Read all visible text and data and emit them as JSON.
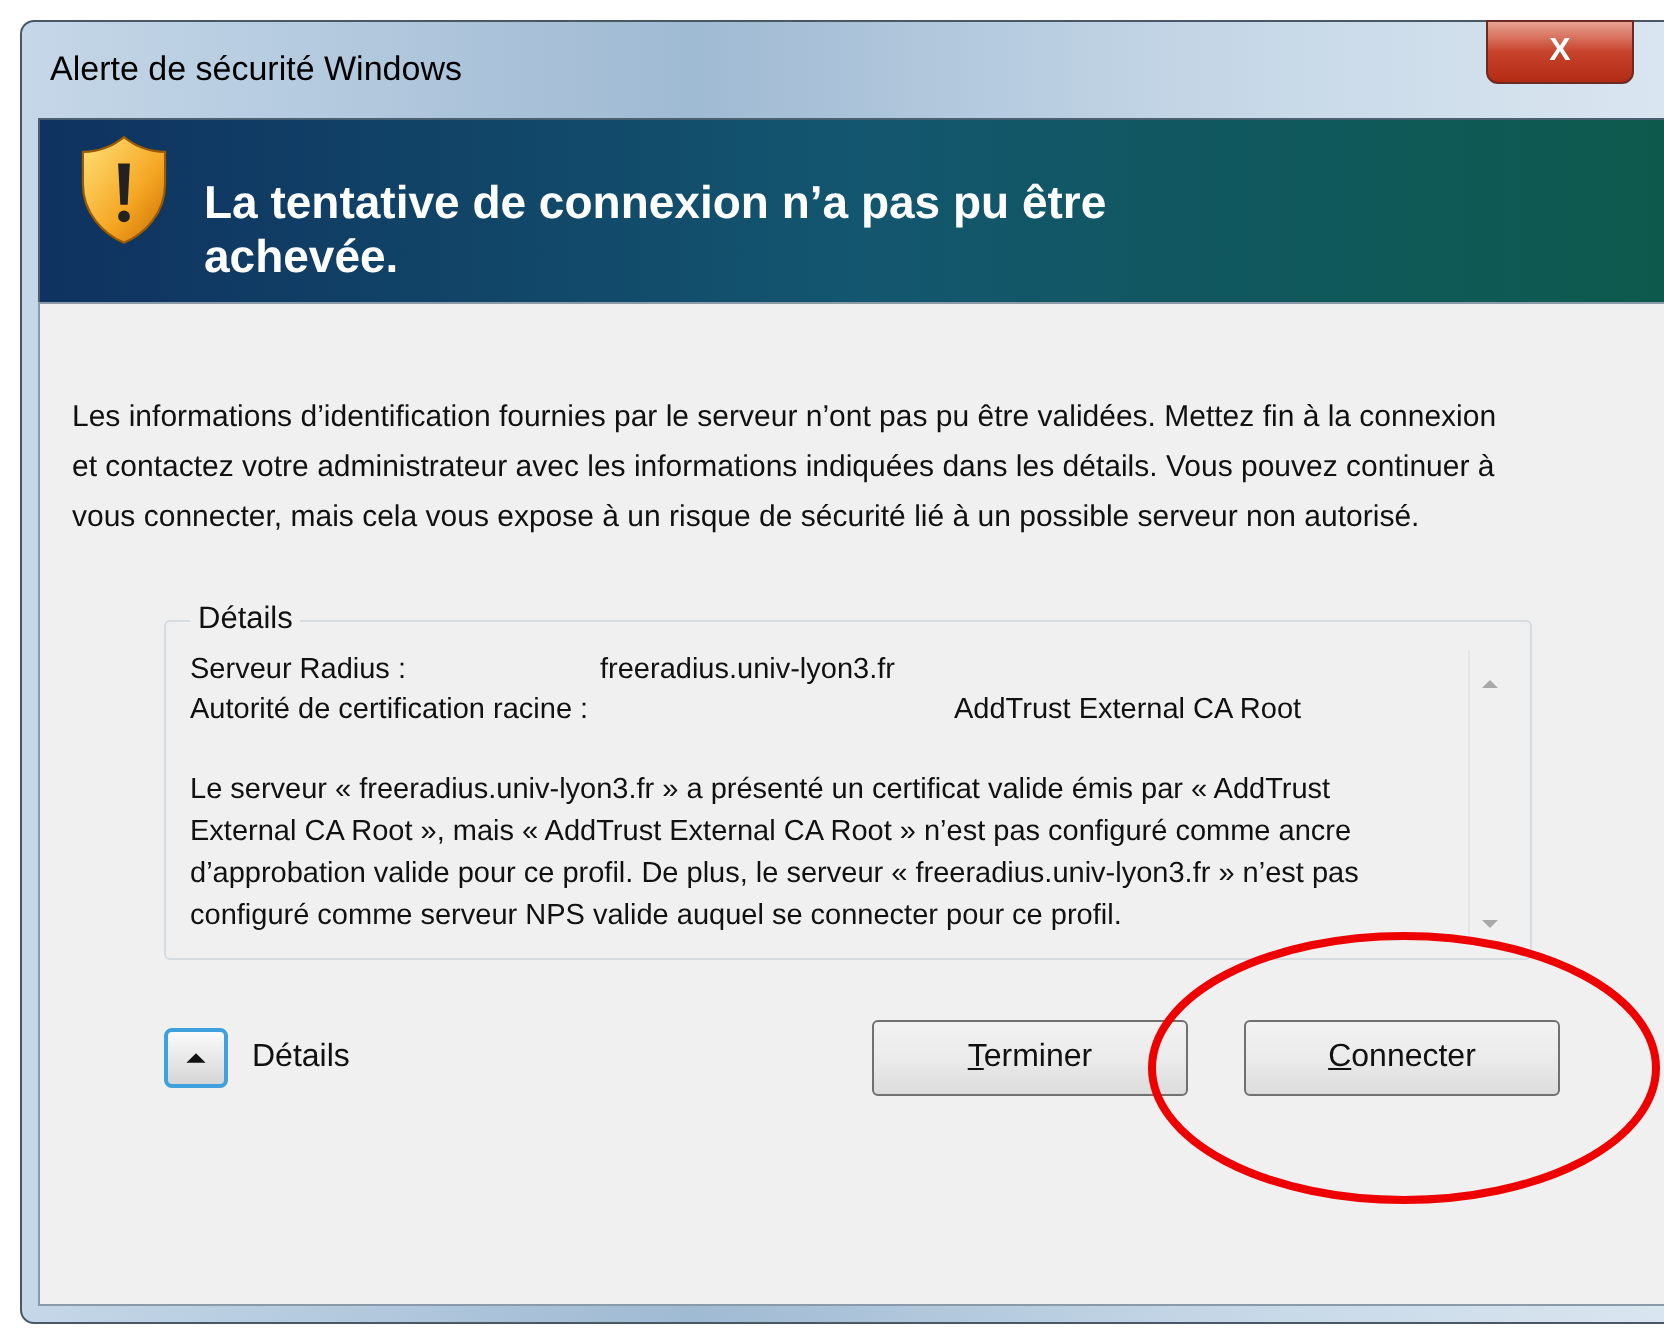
{
  "window": {
    "title": "Alerte de sécurité Windows",
    "close_label": "X"
  },
  "banner": {
    "heading": "La tentative de connexion n’a pas pu être achevée."
  },
  "message": "Les informations d’identification fournies par le serveur n’ont pas pu être validées. Mettez fin à la connexion et contactez votre administrateur avec les informations indiquées dans les détails. Vous pouvez continuer à vous connecter, mais cela vous expose à un risque de sécurité lié à un possible serveur non autorisé.",
  "details": {
    "title": "Détails",
    "fields": [
      {
        "label": "Serveur Radius :",
        "value": "freeradius.univ-lyon3.fr"
      },
      {
        "label": "Autorité de certification racine :",
        "value": "AddTrust External CA Root"
      }
    ],
    "text": "Le serveur « freeradius.univ-lyon3.fr » a présenté un certificat valide émis par « AddTrust External CA Root », mais « AddTrust External CA Root » n’est pas configuré comme ancre d’approbation valide pour ce profil. De plus, le serveur « freeradius.univ-lyon3.fr » n’est pas configuré comme serveur NPS valide auquel se connecter pour ce profil."
  },
  "footer": {
    "details_toggle": {
      "label": "Détails",
      "expanded": true
    },
    "buttons": [
      {
        "label": "Terminer",
        "highlighted": false
      },
      {
        "label": "Connecter",
        "highlighted": true
      }
    ]
  }
}
